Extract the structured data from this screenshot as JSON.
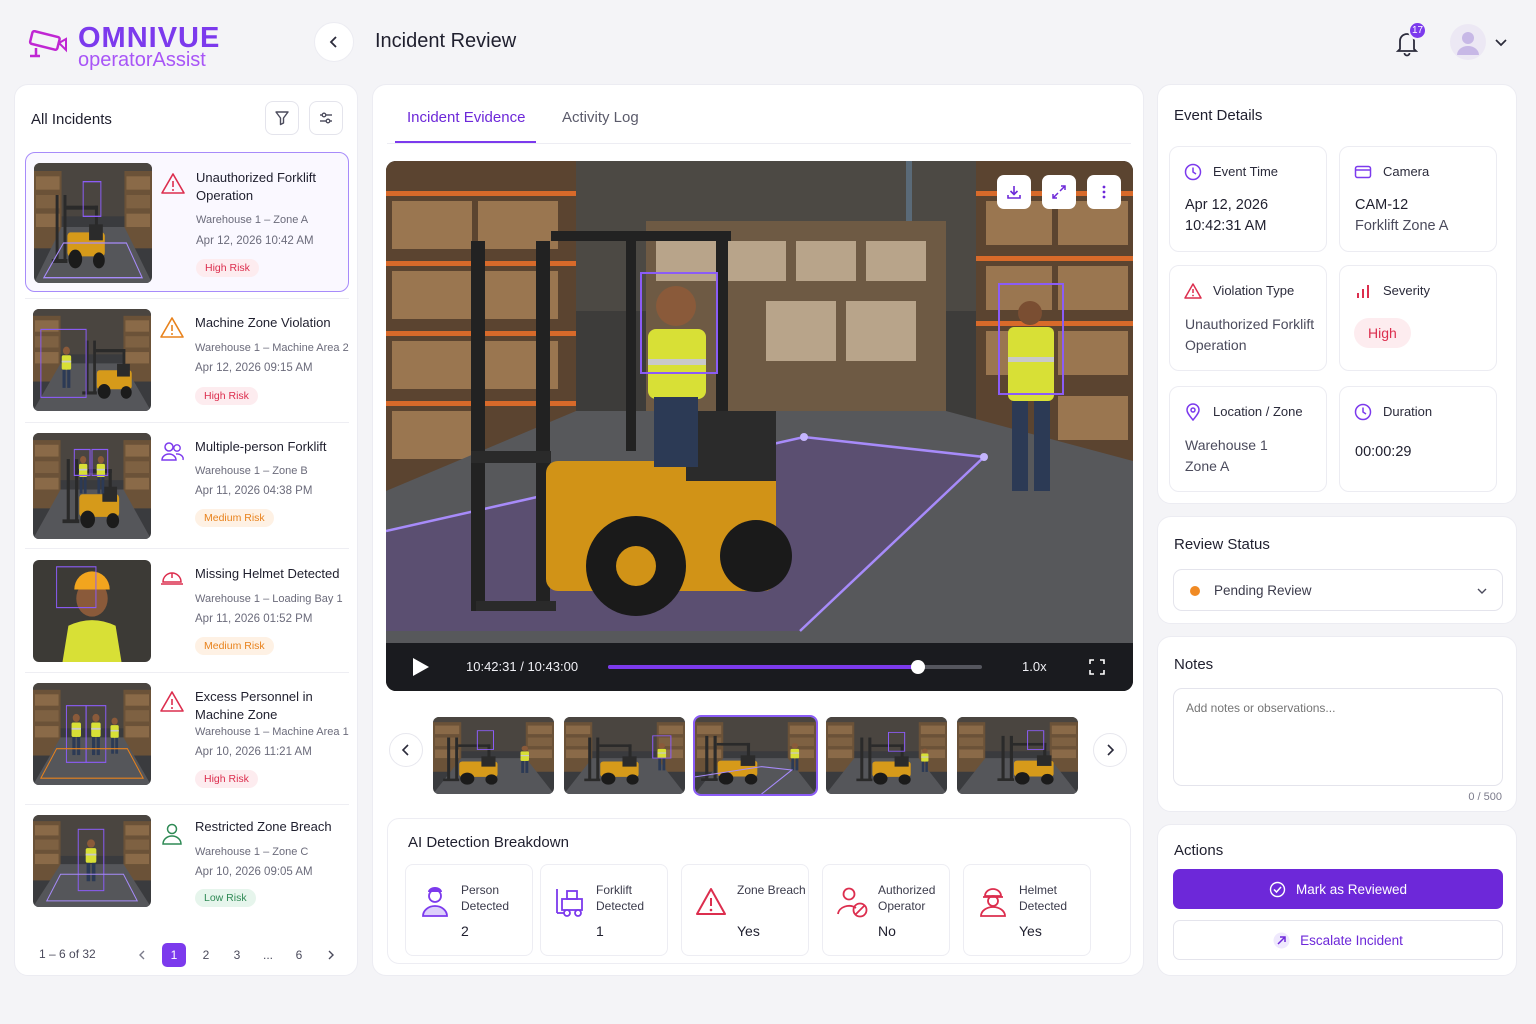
{
  "app": {
    "brand": "OMNIVUE",
    "sub": "operatorAssist",
    "page_title": "Incident Review",
    "notification_count": "17"
  },
  "incidents": {
    "heading": "All Incidents",
    "items": [
      {
        "title": "Unauthorized Forklift Operation",
        "location": "Warehouse 1 – Zone A",
        "date": "Apr 12, 2026 10:42 AM",
        "risk": "High Risk"
      },
      {
        "title": "Machine Zone Violation",
        "location": "Warehouse 1 – Machine Area 2",
        "date": "Apr 12, 2026 09:15 AM",
        "risk": "High Risk"
      },
      {
        "title": "Multiple-person Forklift",
        "location": "Warehouse 1 – Zone B",
        "date": "Apr 11, 2026 04:38 PM",
        "risk": "Medium Risk"
      },
      {
        "title": "Missing Helmet Detected",
        "location": "Warehouse 1 – Loading Bay 1",
        "date": "Apr 11, 2026 01:52 PM",
        "risk": "Medium Risk"
      },
      {
        "title": "Excess Personnel in Machine Zone",
        "location": "Warehouse 1 – Machine Area 1",
        "date": "Apr 10, 2026 11:21 AM",
        "risk": "High Risk"
      },
      {
        "title": "Restricted Zone Breach",
        "location": "Warehouse 1 – Zone C",
        "date": "Apr 10, 2026 09:05 AM",
        "risk": "Low Risk"
      }
    ],
    "pager": {
      "count": "1 – 6 of 32",
      "pages": [
        "1",
        "2",
        "3",
        "...",
        "6"
      ]
    }
  },
  "tabs": [
    "Incident Evidence",
    "Activity Log"
  ],
  "player": {
    "time": "10:42:31 / 10:43:00",
    "progress": 0.83,
    "speed": "1.0x"
  },
  "ai": {
    "title": "AI Detection Breakdown",
    "cards": [
      {
        "label": "Person Detected",
        "value": "2",
        "icon": "person-icon"
      },
      {
        "label": "Forklift Detected",
        "value": "1",
        "icon": "forklift-icon"
      },
      {
        "label": "Zone Breach",
        "value": "Yes",
        "icon": "warning-icon"
      },
      {
        "label": "Authorized Operator",
        "value": "No",
        "icon": "operator-denied-icon"
      },
      {
        "label": "Helmet Detected",
        "value": "Yes",
        "icon": "helmet-icon"
      }
    ]
  },
  "event": {
    "title": "Event Details",
    "time_label": "Event Time",
    "time_date": "Apr 12, 2026",
    "time_clock": "10:42:31 AM",
    "camera_label": "Camera",
    "camera_id": "CAM-12",
    "camera_name": "Forklift Zone A",
    "violation_label": "Violation Type",
    "violation_value": "Unauthorized Forklift Operation",
    "severity_label": "Severity",
    "severity_value": "High",
    "location_label": "Location / Zone",
    "location_line1": "Warehouse 1",
    "location_line2": "Zone A",
    "duration_label": "Duration",
    "duration_value": "00:00:29"
  },
  "review": {
    "title": "Review Status",
    "status": "Pending Review"
  },
  "notes": {
    "title": "Notes",
    "placeholder": "Add notes or observations...",
    "count": "0 / 500"
  },
  "actions": {
    "title": "Actions",
    "primary": "Mark as Reviewed",
    "secondary": "Escalate Incident"
  },
  "colors": {
    "accent": "#7c3aed",
    "high": "#dc2e4e",
    "medium": "#e8821c",
    "low": "#2f8a55"
  }
}
